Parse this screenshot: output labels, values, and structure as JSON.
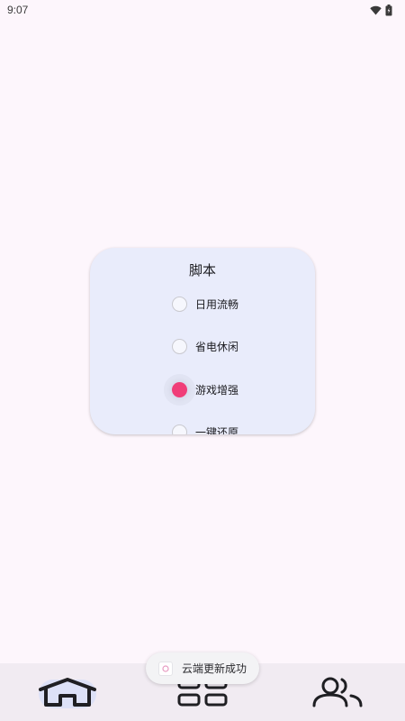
{
  "status_bar": {
    "time": "9:07",
    "icons": [
      "wifi-icon",
      "battery-icon"
    ]
  },
  "script_card": {
    "title": "脚本",
    "options": [
      {
        "label": "日用流畅",
        "selected": false
      },
      {
        "label": "省电休闲",
        "selected": false
      },
      {
        "label": "游戏增强",
        "selected": true
      },
      {
        "label": "一键还原",
        "selected": false
      }
    ]
  },
  "toast": {
    "text": "云端更新成功",
    "icon": "app-icon"
  },
  "bottom_nav": {
    "items": [
      {
        "icon": "home-icon",
        "active": true
      },
      {
        "icon": "apps-icon",
        "active": false
      },
      {
        "icon": "users-icon",
        "active": false
      }
    ]
  },
  "colors": {
    "background": "#fdf6fc",
    "card": "#e9ecfb",
    "accent": "#f03d78",
    "nav_background": "#f1ebf2",
    "nav_indicator": "#dde1f7"
  }
}
